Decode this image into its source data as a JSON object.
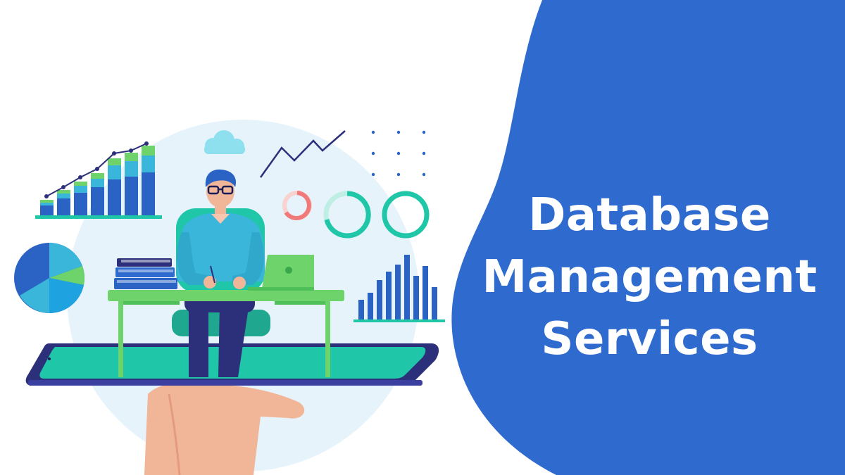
{
  "banner": {
    "title_lines": [
      "Database",
      "Management",
      "Services"
    ]
  },
  "colors": {
    "panel_blue": "#2f6bce",
    "illustration_blue": "#2b63c4",
    "green": "#6fd36b",
    "teal": "#1fc6a8",
    "cyan": "#39b6da",
    "navy": "#2c2f7a",
    "light_circle": "#e6f3fb",
    "skin": "#f1b598",
    "coral": "#f07a7a"
  },
  "icons": [
    "bar-chart-icon",
    "pie-chart-icon",
    "cloud-icon",
    "line-trend-icon",
    "dot-grid-icon",
    "donut-ring-icon",
    "histogram-icon",
    "laptop-icon",
    "book-stack-icon",
    "smartphone-icon",
    "hand-icon",
    "person-icon"
  ]
}
